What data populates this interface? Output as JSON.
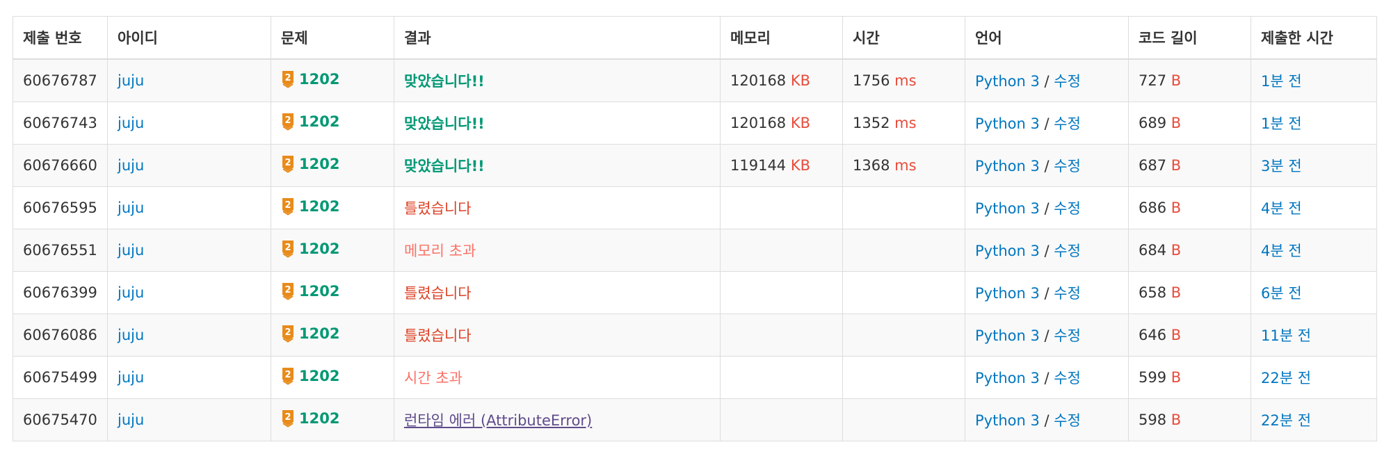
{
  "colors": {
    "link": "#0076c0",
    "unit": "#e74c3c",
    "accepted": "#009874",
    "wrong": "#dd4124",
    "limit_exceeded": "#fa7268",
    "runtime_error": "#5f4b8b",
    "tier_bronze": "#e88b1a"
  },
  "headers": [
    "제출 번호",
    "아이디",
    "문제",
    "결과",
    "메모리",
    "시간",
    "언어",
    "코드 길이",
    "제출한 시간"
  ],
  "tier_icon": "bronze-tier-2-icon",
  "tier_level": "2",
  "lang_sep": "/",
  "rows": [
    {
      "id": "60676787",
      "user": "juju",
      "problem": "1202",
      "result": "맞았습니다!!",
      "result_type": "ac",
      "memory": "120168",
      "memory_unit": "KB",
      "time": "1756",
      "time_unit": "ms",
      "lang": "Python 3",
      "edit": "수정",
      "code_len": "727",
      "code_unit": "B",
      "submitted": "1분 전"
    },
    {
      "id": "60676743",
      "user": "juju",
      "problem": "1202",
      "result": "맞았습니다!!",
      "result_type": "ac",
      "memory": "120168",
      "memory_unit": "KB",
      "time": "1352",
      "time_unit": "ms",
      "lang": "Python 3",
      "edit": "수정",
      "code_len": "689",
      "code_unit": "B",
      "submitted": "1분 전"
    },
    {
      "id": "60676660",
      "user": "juju",
      "problem": "1202",
      "result": "맞았습니다!!",
      "result_type": "ac",
      "memory": "119144",
      "memory_unit": "KB",
      "time": "1368",
      "time_unit": "ms",
      "lang": "Python 3",
      "edit": "수정",
      "code_len": "687",
      "code_unit": "B",
      "submitted": "3분 전"
    },
    {
      "id": "60676595",
      "user": "juju",
      "problem": "1202",
      "result": "틀렸습니다",
      "result_type": "wa",
      "memory": "",
      "memory_unit": "",
      "time": "",
      "time_unit": "",
      "lang": "Python 3",
      "edit": "수정",
      "code_len": "686",
      "code_unit": "B",
      "submitted": "4분 전"
    },
    {
      "id": "60676551",
      "user": "juju",
      "problem": "1202",
      "result": "메모리 초과",
      "result_type": "limit",
      "memory": "",
      "memory_unit": "",
      "time": "",
      "time_unit": "",
      "lang": "Python 3",
      "edit": "수정",
      "code_len": "684",
      "code_unit": "B",
      "submitted": "4분 전"
    },
    {
      "id": "60676399",
      "user": "juju",
      "problem": "1202",
      "result": "틀렸습니다",
      "result_type": "wa",
      "memory": "",
      "memory_unit": "",
      "time": "",
      "time_unit": "",
      "lang": "Python 3",
      "edit": "수정",
      "code_len": "658",
      "code_unit": "B",
      "submitted": "6분 전"
    },
    {
      "id": "60676086",
      "user": "juju",
      "problem": "1202",
      "result": "틀렸습니다",
      "result_type": "wa",
      "memory": "",
      "memory_unit": "",
      "time": "",
      "time_unit": "",
      "lang": "Python 3",
      "edit": "수정",
      "code_len": "646",
      "code_unit": "B",
      "submitted": "11분 전"
    },
    {
      "id": "60675499",
      "user": "juju",
      "problem": "1202",
      "result": "시간 초과",
      "result_type": "limit",
      "memory": "",
      "memory_unit": "",
      "time": "",
      "time_unit": "",
      "lang": "Python 3",
      "edit": "수정",
      "code_len": "599",
      "code_unit": "B",
      "submitted": "22분 전"
    },
    {
      "id": "60675470",
      "user": "juju",
      "problem": "1202",
      "result": "런타임 에러 (AttributeError)",
      "result_type": "rte",
      "memory": "",
      "memory_unit": "",
      "time": "",
      "time_unit": "",
      "lang": "Python 3",
      "edit": "수정",
      "code_len": "598",
      "code_unit": "B",
      "submitted": "22분 전"
    }
  ]
}
